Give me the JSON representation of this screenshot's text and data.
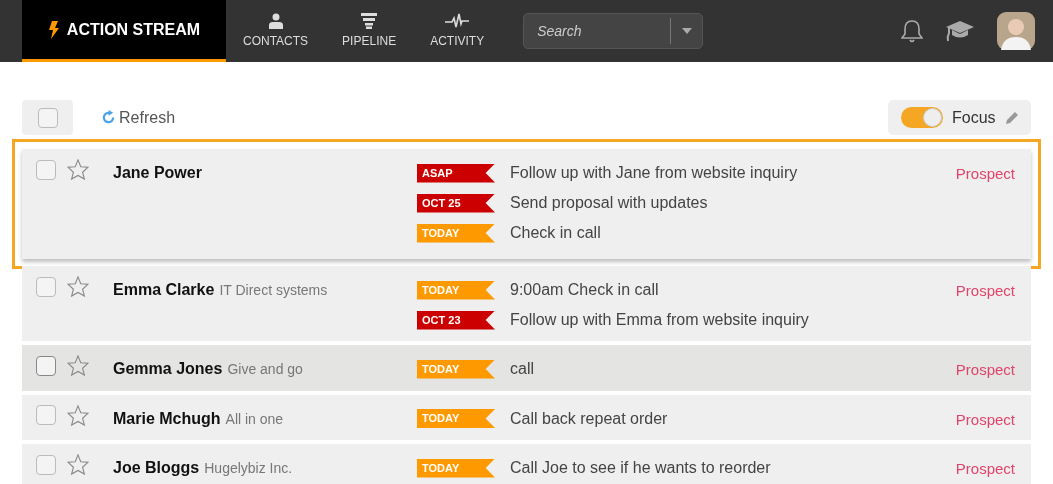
{
  "nav": {
    "brand": {
      "label": "ACTION STREAM",
      "selected": true
    },
    "items": [
      {
        "label": "CONTACTS",
        "kind": "person",
        "selected": false
      },
      {
        "label": "PIPELINE",
        "kind": "funnel",
        "selected": false
      },
      {
        "label": "ACTIVITY",
        "kind": "pulse",
        "selected": false
      }
    ],
    "search": {
      "placeholder": "Search"
    }
  },
  "toolbar": {
    "select_all": {
      "checked": false
    },
    "refresh": "Refresh",
    "focus": {
      "label": "Focus",
      "on": true
    }
  },
  "rows": [
    {
      "name": "Jane Power",
      "checked": false,
      "starred": false,
      "focused": true,
      "hovered": false,
      "status": "Prospect",
      "tasks": [
        {
          "tag": "ASAP",
          "color": "#cc0000",
          "text": "Follow up with Jane from website inquiry"
        },
        {
          "tag": "OCT 25",
          "color": "#cc0000",
          "text": "Send proposal with updates"
        },
        {
          "tag": "TODAY",
          "color": "#ff9900",
          "text": "Check in call"
        }
      ]
    },
    {
      "name": "Emma Clarke",
      "company": "IT Direct systems",
      "checked": false,
      "starred": false,
      "focused": false,
      "hovered": false,
      "status": "Prospect",
      "tasks": [
        {
          "tag": "TODAY",
          "color": "#ff9900",
          "text": "9:00am Check in call"
        },
        {
          "tag": "OCT 23",
          "color": "#cc0000",
          "text": "Follow up with Emma from website inquiry"
        }
      ]
    },
    {
      "name": "Gemma Jones",
      "company": "Give and go",
      "checked": false,
      "starred": false,
      "focused": false,
      "hovered": true,
      "status": "Prospect",
      "tasks": [
        {
          "tag": "TODAY",
          "color": "#ff9900",
          "text": "call"
        }
      ]
    },
    {
      "name": "Marie Mchugh",
      "company": "All in one",
      "checked": false,
      "starred": false,
      "focused": false,
      "hovered": false,
      "status": "Prospect",
      "tasks": [
        {
          "tag": "TODAY",
          "color": "#ff9900",
          "text": "Call back repeat order"
        }
      ]
    },
    {
      "name": "Joe Bloggs",
      "company": "Hugelybiz Inc.",
      "checked": false,
      "starred": false,
      "focused": false,
      "hovered": false,
      "status": "Prospect",
      "tasks": [
        {
          "tag": "TODAY",
          "color": "#ff9900",
          "text": "Call Joe to see if he wants to reorder"
        }
      ]
    }
  ]
}
